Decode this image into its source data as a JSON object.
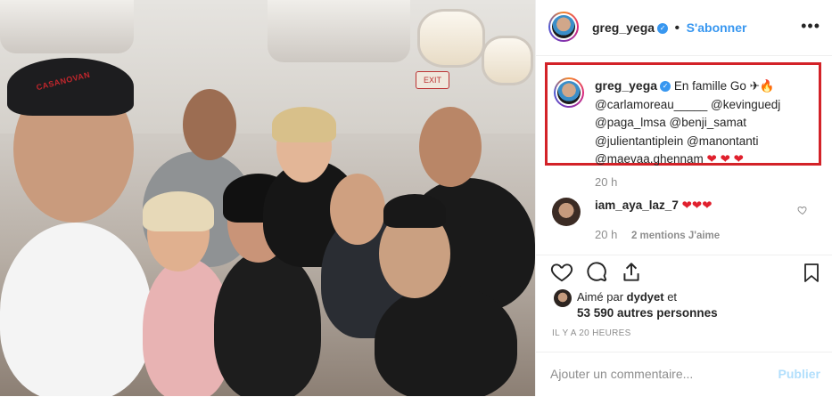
{
  "post": {
    "photo_alt": "Group selfie inside an airplane cabin",
    "cap_text": "CASANOVAN",
    "exit_sign": "EXIT"
  },
  "header": {
    "username": "greg_yega",
    "follow_label": "S'abonner",
    "separator": "•",
    "more_label": "•••"
  },
  "caption": {
    "username": "greg_yega",
    "text_prefix": "En famille Go",
    "emojis_after_prefix": "✈🔥",
    "mentions_line1": "@carlamoreau_____ @kevinguedj",
    "mentions_line2": "@paga_lmsa @benji_samat",
    "mentions_line3": "@julientantiplein @manontanti",
    "mentions_line4": "@maevaa.ghennam",
    "hearts": "❤ ❤ ❤",
    "time": "20 h"
  },
  "comment": {
    "username": "iam_aya_laz_7",
    "hearts": "❤❤❤",
    "time": "20 h",
    "likes": "2 mentions J'aime"
  },
  "likes": {
    "liked_by_prefix": "Aimé par",
    "liked_by_user": "dydyet",
    "liked_by_suffix": "et",
    "count_text": "53 590 autres personnes"
  },
  "date": "IL Y A 20 HEURES",
  "comment_box": {
    "placeholder": "Ajouter un commentaire...",
    "publish_label": "Publier"
  },
  "colors": {
    "accent": "#3897f0",
    "highlight_box": "#d32228",
    "heart": "#e0202d",
    "muted": "#8e8e8e"
  },
  "icons": [
    "heart-icon",
    "comment-icon",
    "share-icon",
    "bookmark-icon",
    "verified-icon",
    "more-icon"
  ]
}
